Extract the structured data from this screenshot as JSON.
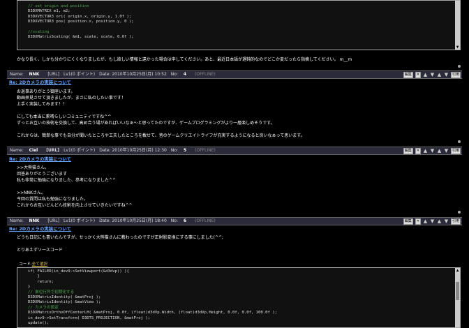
{
  "top_code": [
    "// set origin and position",
    "D3DXMATRIX m1, m2;",
    "D3DXVECTOR3 ori( origin.x, origin.y, 1.0f );",
    "D3DXVECTOR3 pos( position.x, position.y, 0 );",
    "",
    "//scaling",
    "D3DXMatrixScaling( &m1, scale, scale, 0.0f );"
  ],
  "top_note": "かなり長く、しかも分かりにくくなりましたが、もし欲しい情報と違かった場合は申してください。あと、最近日本語が遅鈍的なのでどこか変だったら指摘してください。 m__m",
  "posts": [
    {
      "header": {
        "name_label": "Name:",
        "name": "NNK",
        "url": "[URL]",
        "level": "Lv1(0 ポイント)",
        "date": "Date: 2010年10月25日(月) 10:52",
        "no_label": "No:",
        "no": "4",
        "status": "(OFFLINE)"
      },
      "title": "Re: 2Dカメラの実装について",
      "lines": [
        "お返事ありがとう御座います。",
        "動画拝見させて頂きましたが、まさに私のしたい事です！",
        "上手く実装してみます！！",
        "",
        "にしても本当に素晴らしいコミュニティですね^^",
        "ずっとお互いの技術を交換して、高め合う場があればいいなぁ～と思ってたのですが、ゲームプログラミングがより一層楽しめそうです。",
        "",
        "これからは、簡単な事でも自分が聞いたところや工夫したところを載せて、皆のゲームクリエイトライフが充実するようになると良いなぁって思います。"
      ]
    },
    {
      "header": {
        "name_label": "Name:",
        "name": "Ciel",
        "url": "[URL]",
        "level": "Lv1(0 ポイント)",
        "date": "Date: 2010年10月25日(月) 12:30",
        "no_label": "No:",
        "no": "5",
        "status": "(OFFLINE)"
      },
      "title": "Re: 2Dカメラの実装について",
      "lines": [
        ">>大熊猫さん。",
        "回答ありがとうございます",
        "私も非常に勉強になりました、参考になりました^^",
        "",
        ">>NNKさん。",
        "今回の質問は私も勉強になりました。",
        "これからお互いどんどん技術を向上させていきたいですね^^"
      ]
    },
    {
      "header": {
        "name_label": "Name:",
        "name": "NNK",
        "url": "[URL]",
        "level": "Lv1(0 ポイント)",
        "date": "Date: 2010年10月25日(月) 18:40",
        "no_label": "No:",
        "no": "6",
        "status": "(OFFLINE)"
      },
      "title": "Re: 2Dカメラの実装について",
      "lines": [
        "どうも日記にも書いたんですが、せっかく大熊猫さんに教わったのですが正射影変換にする事にしました(^^;",
        "",
        "とりあえずソースコード"
      ]
    }
  ],
  "tools": {
    "edit": "編集",
    "del": "✕",
    "up": "▲",
    "down": "▼",
    "quote": "引用"
  },
  "code_header": {
    "label": "コード:",
    "link": "全て選択"
  },
  "bottom_code": [
    "if( FAILED(in_dev9->SetViewport(&d3dvp)) ){",
    "    }",
    "    return;",
    "}",
    "// 単位行列で初期化する",
    "D3DXMatrixIdentity( &matProj );",
    "D3DXMatrixIdentity( &matView );",
    "// カメラの設定",
    "D3DXMatrixOrthoOffCenterLH( &matProj, 0.0f, (float)d3dVp.Width, (float)d3dVp.Height, 0.0f, 0.0f, 100.0f );",
    "in_dev9->SetTransform( D3DTS_PROJECTION, &matProj );",
    "update();"
  ]
}
